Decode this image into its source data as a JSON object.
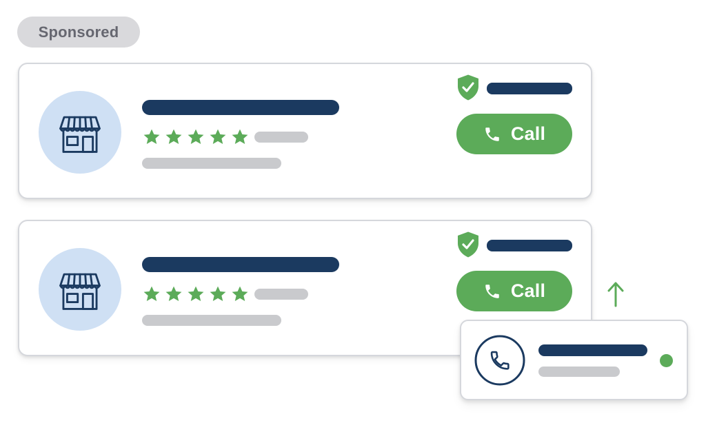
{
  "sponsored_label": "Sponsored",
  "listings": [
    {
      "store_icon": "storefront-icon",
      "rating_stars": 5,
      "verified_icon": "shield-check-icon",
      "call_icon": "phone-icon",
      "call_label": "Call"
    },
    {
      "store_icon": "storefront-icon",
      "rating_stars": 5,
      "verified_icon": "shield-check-icon",
      "call_icon": "phone-icon",
      "call_label": "Call"
    }
  ],
  "arrow_icon": "arrow-up-icon",
  "call_notification": {
    "icon": "phone-circle-icon",
    "status": "online",
    "status_color": "#5cab59"
  },
  "colors": {
    "accent_green": "#5cab59",
    "navy": "#1b3a60",
    "placeholder_gray": "#c9cacd",
    "avatar_blue": "#cfe0f4",
    "sponsored_bg": "#d9d9dc"
  }
}
